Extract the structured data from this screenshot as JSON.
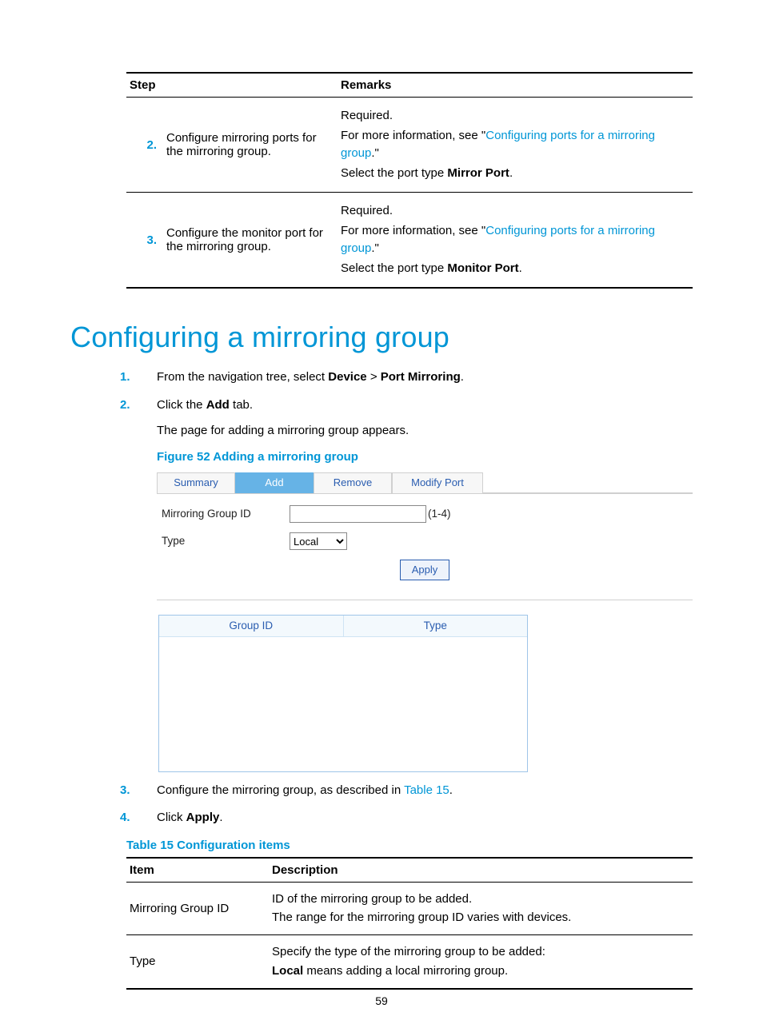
{
  "colors": {
    "accent": "#0096d6",
    "tabActive": "#66b3e6",
    "linkBlue": "#2a5db0"
  },
  "stepTable": {
    "headers": {
      "step": "Step",
      "remarks": "Remarks"
    },
    "rows": [
      {
        "num": "2.",
        "text": "Configure mirroring ports for the mirroring group.",
        "required": "Required.",
        "info_prefix": "For more information, see \"",
        "info_link": "Configuring ports for a mirroring group",
        "info_suffix": ".\"",
        "select_prefix": "Select the port type ",
        "select_bold": "Mirror Port",
        "select_suffix": "."
      },
      {
        "num": "3.",
        "text": "Configure the monitor port for the mirroring group.",
        "required": "Required.",
        "info_prefix": "For more information, see \"",
        "info_link": "Configuring ports for a mirroring group",
        "info_suffix": ".\"",
        "select_prefix": "Select the port type ",
        "select_bold": "Monitor Port",
        "select_suffix": "."
      }
    ]
  },
  "heading": "Configuring a mirroring group",
  "steps1": [
    {
      "marker": "1.",
      "prefix": "From the navigation tree, select ",
      "b1": "Device",
      "sep": " > ",
      "b2": "Port Mirroring",
      "suffix": "."
    },
    {
      "marker": "2.",
      "prefix": "Click the ",
      "b1": "Add",
      "suffix": " tab.",
      "extra": "The page for adding a mirroring group appears."
    }
  ],
  "figure52": {
    "caption": "Figure 52 Adding a mirroring group",
    "tabs": {
      "summary": "Summary",
      "add": "Add",
      "remove": "Remove",
      "modify": "Modify Port"
    },
    "form": {
      "groupIdLabel": "Mirroring Group ID",
      "groupIdValue": "",
      "groupIdHint": "(1-4)",
      "typeLabel": "Type",
      "typeValue": "Local",
      "apply": "Apply"
    },
    "grid": {
      "col1": "Group ID",
      "col2": "Type"
    }
  },
  "steps2": [
    {
      "marker": "3.",
      "prefix": "Configure the mirroring group, as described in ",
      "link": "Table 15",
      "suffix": "."
    },
    {
      "marker": "4.",
      "prefix": "Click ",
      "b1": "Apply",
      "suffix": "."
    }
  ],
  "table15": {
    "caption": "Table 15 Configuration items",
    "headers": {
      "item": "Item",
      "desc": "Description"
    },
    "rows": [
      {
        "item": "Mirroring Group ID",
        "l1": "ID of the mirroring group to be added.",
        "l2": "The range for the mirroring group ID varies with devices."
      },
      {
        "item": "Type",
        "l1": "Specify the type of the mirroring group to be added:",
        "l2_bold": "Local",
        "l2_rest": " means adding a local mirroring group."
      }
    ]
  },
  "pageNumber": "59"
}
